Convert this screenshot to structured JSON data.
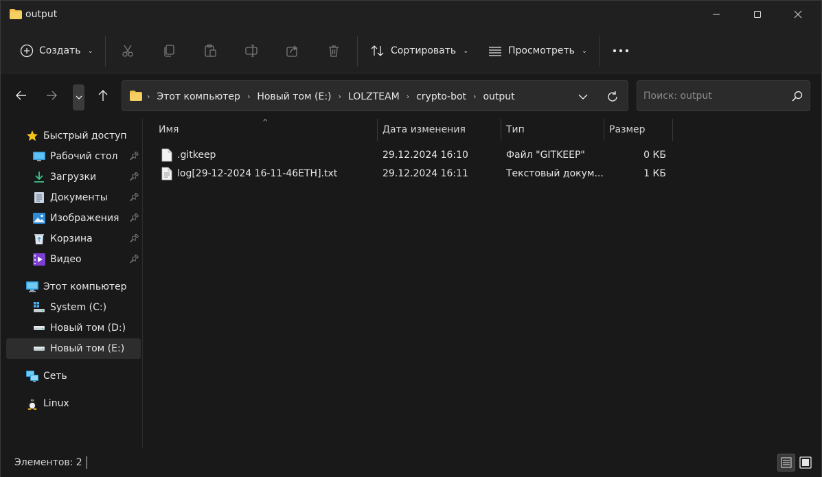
{
  "window": {
    "title": "output"
  },
  "commandbar": {
    "new_label": "Создать",
    "sort_label": "Сортировать",
    "view_label": "Просмотреть",
    "icons": [
      "cut-icon",
      "copy-icon",
      "paste-icon",
      "rename-icon",
      "share-icon",
      "delete-icon"
    ]
  },
  "address": {
    "crumbs": [
      "Этот компьютер",
      "Новый том (E:)",
      "LOLZTEAM",
      "crypto-bot",
      "output"
    ]
  },
  "search": {
    "placeholder": "Поиск: output"
  },
  "sidebar": {
    "quick_access": "Быстрый доступ",
    "quick_items": [
      {
        "label": "Рабочий стол",
        "icon": "desktop-icon",
        "pinned": true
      },
      {
        "label": "Загрузки",
        "icon": "downloads-icon",
        "pinned": true
      },
      {
        "label": "Документы",
        "icon": "documents-icon",
        "pinned": true
      },
      {
        "label": "Изображения",
        "icon": "pictures-icon",
        "pinned": true
      },
      {
        "label": "Корзина",
        "icon": "recycle-bin-icon",
        "pinned": true
      },
      {
        "label": "Видео",
        "icon": "videos-icon",
        "pinned": true
      }
    ],
    "this_pc": "Этот компьютер",
    "drives": [
      {
        "label": "System (C:)",
        "icon": "system-drive-icon"
      },
      {
        "label": "Новый том (D:)",
        "icon": "drive-icon"
      },
      {
        "label": "Новый том (E:)",
        "icon": "drive-icon",
        "selected": true
      }
    ],
    "network": "Сеть",
    "linux": "Linux"
  },
  "columns": {
    "name": "Имя",
    "date": "Дата изменения",
    "type": "Тип",
    "size": "Размер"
  },
  "files": [
    {
      "name": ".gitkeep",
      "date": "29.12.2024 16:10",
      "type": "Файл \"GITKEEP\"",
      "size": "0 КБ"
    },
    {
      "name": "log[29-12-2024 16-11-46ETH].txt",
      "date": "29.12.2024 16:11",
      "type": "Текстовый докум...",
      "size": "1 КБ"
    }
  ],
  "status": {
    "items_text": "Элементов: 2"
  },
  "colors": {
    "background": "#191919",
    "chrome": "#202020",
    "text": "#e6e6e6",
    "folder": "#f2c14e",
    "accent": "#4aa3ff"
  }
}
